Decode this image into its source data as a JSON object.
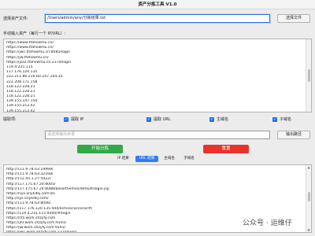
{
  "window": {
    "title": "资产分拣工具 V1.0"
  },
  "asset_file": {
    "label": "选择资产文件:",
    "value": "/Users/admin/any/分拣结果.txt",
    "button": "选择文件"
  },
  "manual_input": {
    "label": "手动输入资产（每行一个 IP/URL）:",
    "lines": [
      "https://www.tfahswmu.cn/",
      "https://www.tfahswmu.cn/",
      "https://jwc.tfahswmu.cn:8085/login",
      "https://jw.tfahswmu.cn/",
      "https://jsxz.tfahswmu.cn:2370/login",
      "119.4.231.115",
      "117.176.120.135",
      "222.211.86.216,60.247.164.35",
      "222.208.171.158",
      "118.122.228.21",
      "118.122.228.21",
      "118.122.228.21",
      "139.155.147.150",
      "139.155.213.42",
      "139.155.213.42"
    ]
  },
  "extract": {
    "label": "提取项:",
    "options": [
      {
        "label": "提取 IP",
        "checked": true
      },
      {
        "label": "提取 URL",
        "checked": true
      },
      {
        "label": "主域名",
        "checked": true
      },
      {
        "label": "子域名",
        "checked": true
      }
    ]
  },
  "output": {
    "placeholder": "请选择输出目录",
    "button": "输出路径"
  },
  "actions": {
    "start": "开始分拣",
    "reset": "重置",
    "start_color": "#2faa48",
    "reset_color": "#e8332c"
  },
  "result_tabs": {
    "tabs": [
      "IP 结果",
      "URL 结果",
      "主域名",
      "子域名"
    ],
    "selected": 1
  },
  "results": [
    "http://111.9.78.63:19999/",
    "http://111.9.78.63:32168/",
    "http://112.45.1.27:5922/",
    "http://117.175.67.20:8005/",
    "http://117.175.67.24:8088/base/themes/default/login.jsp",
    "https://sys.xnykdkj.com:81",
    "http://sys.xnykdkj.com/",
    "http://111.9.78.63:8006/",
    "https://117.176.120.135:444/echinococcosis/#/",
    "https://119.4.231.115:9300/#/login",
    "https://cfz.work.shzyfy.com",
    "https://jhr.work.shzyfy.com:9191/",
    "https://jw.work.shzyfy.com:9191/",
    "https://jwc.work.shzyfy.com:2370/login"
  ],
  "watermark": "公众号 · 运维仔"
}
